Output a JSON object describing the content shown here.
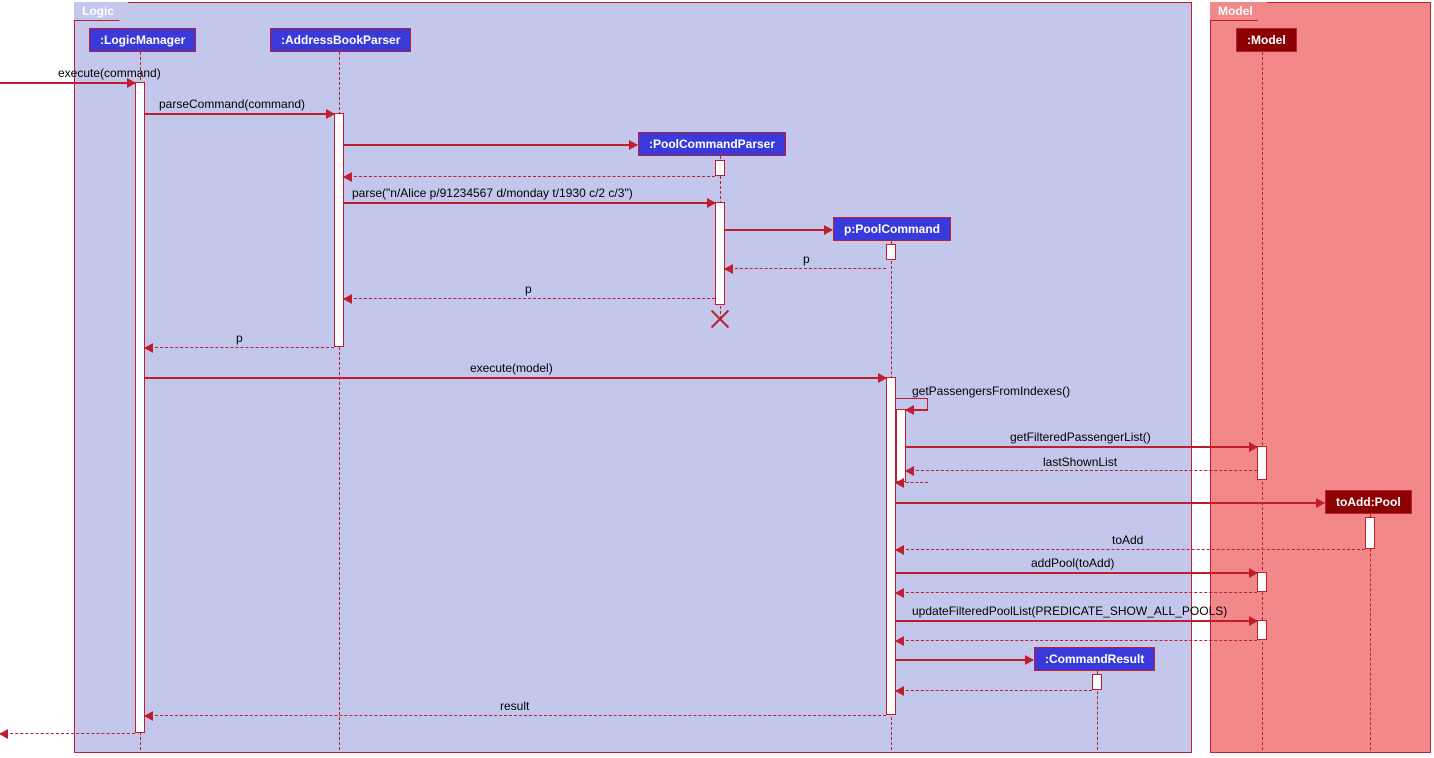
{
  "frames": {
    "logic": "Logic",
    "model": "Model"
  },
  "participants": {
    "logicManager": ":LogicManager",
    "addressBookParser": ":AddressBookParser",
    "poolCommandParser": ":PoolCommandParser",
    "poolCommand": "p:PoolCommand",
    "commandResult": ":CommandResult",
    "model": ":Model",
    "toAddPool": "toAdd:Pool"
  },
  "messages": {
    "execute": "execute(command)",
    "parseCommand": "parseCommand(command)",
    "parse": "parse(\"n/Alice p/91234567 d/monday t/1930 c/2 c/3\")",
    "pReturn": "p",
    "executeModel": "execute(model)",
    "getPassengers": "getPassengersFromIndexes()",
    "getFiltered": "getFilteredPassengerList()",
    "lastShown": "lastShownList",
    "toAdd": "toAdd",
    "addPool": "addPool(toAdd)",
    "updateFiltered": "updateFilteredPoolList(PREDICATE_SHOW_ALL_POOLS)",
    "result": "result"
  }
}
